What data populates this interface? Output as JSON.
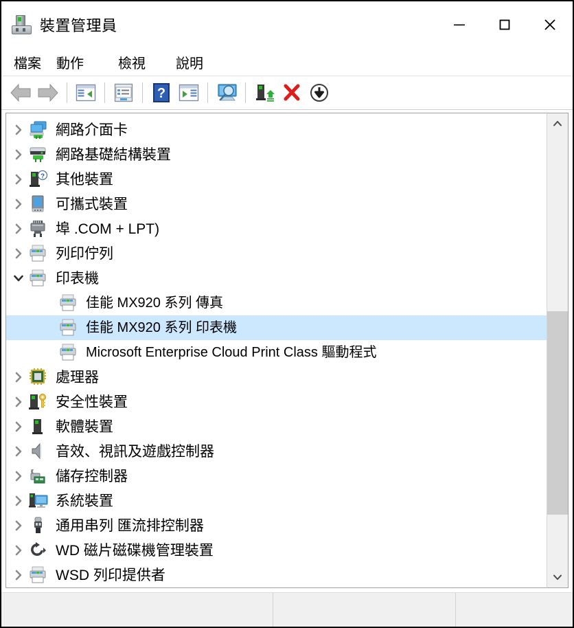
{
  "window": {
    "title": "裝置管理員",
    "icon": "device-manager-icon",
    "controls": {
      "minimize": "minimize-icon",
      "maximize": "maximize-icon",
      "close": "close-icon"
    }
  },
  "menubar": {
    "items": [
      {
        "label": "檔案"
      },
      {
        "label": "動作"
      },
      {
        "label": "檢視"
      },
      {
        "label": "說明"
      }
    ]
  },
  "toolbar": {
    "buttons": [
      {
        "name": "back-button",
        "icon": "back-arrow-icon"
      },
      {
        "name": "forward-button",
        "icon": "forward-arrow-icon"
      },
      {
        "name": "show-tree-button",
        "icon": "tree-panel-icon"
      },
      {
        "name": "properties-button",
        "icon": "properties-window-icon"
      },
      {
        "name": "help-button",
        "icon": "help-question-icon"
      },
      {
        "name": "show-console-tree-button",
        "icon": "play-panel-icon"
      },
      {
        "name": "scan-hardware-changes-button",
        "icon": "monitor-magnifier-icon"
      },
      {
        "name": "update-driver-button",
        "icon": "device-update-icon"
      },
      {
        "name": "uninstall-device-button",
        "icon": "red-x-icon"
      },
      {
        "name": "disable-device-button",
        "icon": "down-arrow-circle-icon"
      }
    ]
  },
  "tree": {
    "rows": [
      {
        "indent": 0,
        "expander": "collapsed",
        "icon": "network-adapter-icon",
        "label": "網路介面卡",
        "selected": false
      },
      {
        "indent": 0,
        "expander": "collapsed",
        "icon": "network-infrastructure-icon",
        "label": "網路基礎結構裝置",
        "selected": false
      },
      {
        "indent": 0,
        "expander": "collapsed",
        "icon": "other-device-icon",
        "label": "其他裝置",
        "selected": false
      },
      {
        "indent": 0,
        "expander": "collapsed",
        "icon": "portable-device-icon",
        "label": "可攜式裝置",
        "selected": false
      },
      {
        "indent": 0,
        "expander": "collapsed",
        "icon": "port-icon",
        "label": "埠 .COM + LPT)",
        "selected": false
      },
      {
        "indent": 0,
        "expander": "collapsed",
        "icon": "print-queue-icon",
        "label": "列印佇列",
        "selected": false
      },
      {
        "indent": 0,
        "expander": "expanded",
        "icon": "printer-icon",
        "label": "印表機",
        "selected": false
      },
      {
        "indent": 1,
        "expander": "none",
        "icon": "printer-icon",
        "label": "佳能    MX920 系列    傳真",
        "selected": false
      },
      {
        "indent": 1,
        "expander": "none",
        "icon": "printer-icon",
        "label": "佳能    MX920 系列    印表機",
        "selected": true
      },
      {
        "indent": 1,
        "expander": "none",
        "icon": "printer-icon",
        "label": "Microsoft Enterprise Cloud    Print Class 驅動程式",
        "selected": false
      },
      {
        "indent": 0,
        "expander": "collapsed",
        "icon": "processor-icon",
        "label": "處理器",
        "selected": false
      },
      {
        "indent": 0,
        "expander": "collapsed",
        "icon": "security-device-icon",
        "label": "安全性裝置",
        "selected": false
      },
      {
        "indent": 0,
        "expander": "collapsed",
        "icon": "software-device-icon",
        "label": "軟體裝置",
        "selected": false
      },
      {
        "indent": 0,
        "expander": "collapsed",
        "icon": "sound-video-game-icon",
        "label": "音效、視訊及遊戲控制器",
        "selected": false
      },
      {
        "indent": 0,
        "expander": "collapsed",
        "icon": "storage-controller-icon",
        "label": "儲存控制器",
        "selected": false
      },
      {
        "indent": 0,
        "expander": "collapsed",
        "icon": "system-device-icon",
        "label": "系統裝置",
        "selected": false
      },
      {
        "indent": 0,
        "expander": "collapsed",
        "icon": "usb-controller-icon",
        "label": "通用串列    匯流排控制器",
        "selected": false
      },
      {
        "indent": 0,
        "expander": "collapsed",
        "icon": "wd-drive-icon",
        "label": "WD 磁片磁碟機管理裝置",
        "selected": false
      },
      {
        "indent": 0,
        "expander": "collapsed",
        "icon": "wsd-print-provider-icon",
        "label": "WSD 列印提供者",
        "selected": false
      }
    ]
  },
  "scrollbar": {
    "up_arrow": "chevron-up-icon",
    "down_arrow": "chevron-down-icon"
  },
  "statusbar": {
    "panes": [
      "",
      "",
      ""
    ]
  },
  "colors": {
    "selection": "#cce8ff",
    "chevron": "#8a8a8a",
    "window_border": "#000000",
    "statusbar_bg": "#f0f0f0"
  }
}
